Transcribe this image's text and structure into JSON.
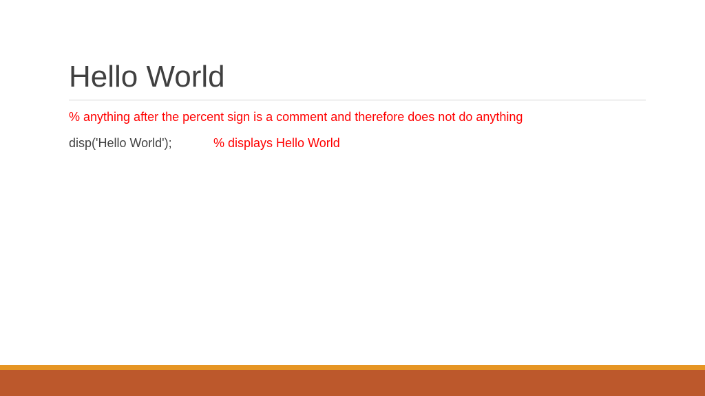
{
  "slide": {
    "title": "Hello World",
    "comment_line": "% anything after the percent sign is a comment and therefore does not do anything",
    "code_line": "disp('Hello World');",
    "code_comment": "% displays Hello World"
  },
  "colors": {
    "title": "#404040",
    "body_text": "#404040",
    "comment": "#ff0000",
    "rule": "#d4d4d4",
    "footer_accent": "#e69523",
    "footer_band": "#bc582c"
  }
}
